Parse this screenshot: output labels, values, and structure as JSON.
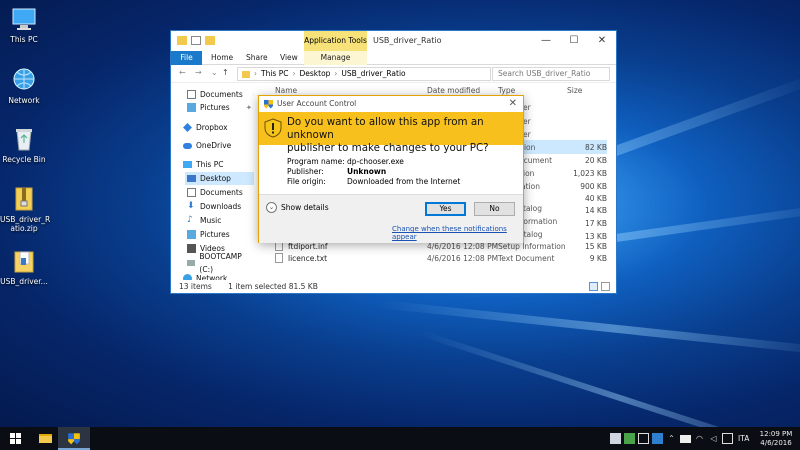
{
  "desktop": {
    "icons": [
      {
        "label": "This PC",
        "icon": "this-pc-icon"
      },
      {
        "label": "Network",
        "icon": "network-icon"
      },
      {
        "label": "Recycle Bin",
        "icon": "recycle-bin-icon"
      },
      {
        "label": "USB_driver_R\natio.zip",
        "icon": "zip-folder-icon"
      },
      {
        "label": "USB_driver...",
        "icon": "folder-icon"
      }
    ]
  },
  "explorer": {
    "context_tab": "Application Tools",
    "title": "USB_driver_Ratio",
    "tabs": {
      "file": "File",
      "home": "Home",
      "share": "Share",
      "view": "View",
      "manage": "Manage"
    },
    "breadcrumb": [
      "This PC",
      "Desktop",
      "USB_driver_Ratio"
    ],
    "search_placeholder": "Search USB_driver_Ratio",
    "nav": {
      "documents": "Documents",
      "pictures": "Pictures",
      "dropbox": "Dropbox",
      "onedrive": "OneDrive",
      "thispc": "This PC",
      "desktop": "Desktop",
      "documents2": "Documents",
      "downloads": "Downloads",
      "music": "Music",
      "pictures2": "Pictures",
      "videos": "Videos",
      "bootcamp": "BOOTCAMP (C:)",
      "network": "Network"
    },
    "columns": {
      "name": "Name",
      "date": "Date modified",
      "type": "Type",
      "size": "Size"
    },
    "partial_types": [
      "er",
      "er",
      "er",
      "tion",
      "ocument",
      "ion",
      "ation",
      "",
      "talog",
      "nformation",
      "atalog"
    ],
    "sizes": [
      "82 KB",
      "20 KB",
      "1,023 KB",
      "900 KB",
      "40 KB",
      "14 KB",
      "17 KB",
      "13 KB"
    ],
    "files": [
      {
        "name": "ftdiport.inf",
        "date": "4/6/2016 12:08 PM",
        "type": "Setup Information",
        "size": "15 KB"
      },
      {
        "name": "licence.txt",
        "date": "4/6/2016 12:08 PM",
        "type": "Text Document",
        "size": "9 KB"
      }
    ],
    "status": {
      "count": "13 items",
      "selected": "1 item selected  81.5 KB"
    }
  },
  "uac": {
    "title": "User Account Control",
    "question_line1": "Do you want to allow this app from an unknown",
    "question_line2": "publisher to make changes to your PC?",
    "program_label": "Program name:",
    "program_value": "dp-chooser.exe",
    "publisher_label": "Publisher:",
    "publisher_value": "Unknown",
    "origin_label": "File origin:",
    "origin_value": "Downloaded from the Internet",
    "show_details": "Show details",
    "yes": "Yes",
    "no": "No",
    "change_link": "Change when these notifications appear"
  },
  "taskbar": {
    "language": "ITA",
    "time": "12:09 PM",
    "date": "4/6/2016"
  }
}
